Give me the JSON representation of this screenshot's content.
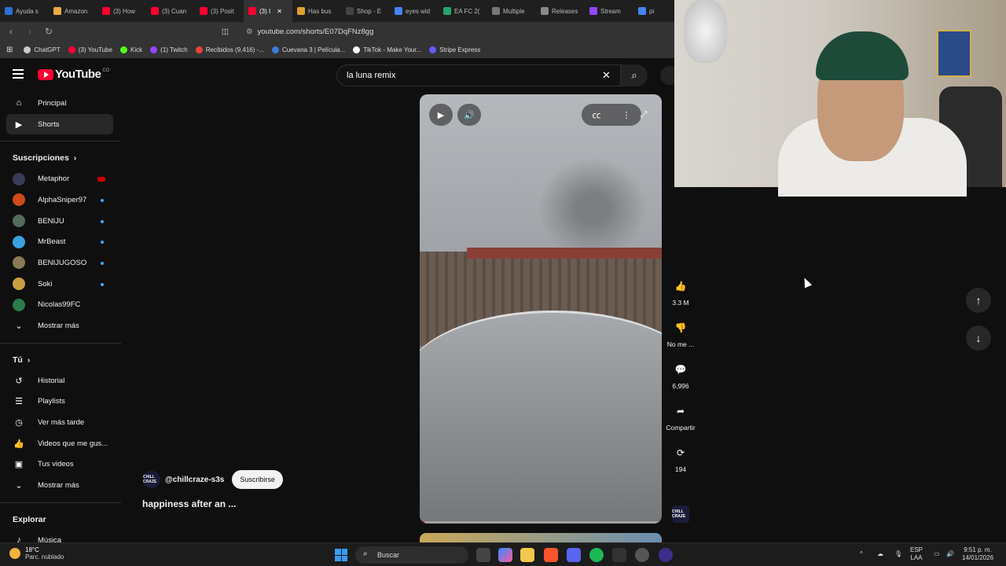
{
  "browser": {
    "tabs": [
      {
        "label": "Ayuda s",
        "color": "#2d6fd6"
      },
      {
        "label": "Amazon",
        "color": "#f3a847"
      },
      {
        "label": "(3) How",
        "color": "#ff0033"
      },
      {
        "label": "(3) Cuan",
        "color": "#ff0033"
      },
      {
        "label": "(3) Posit",
        "color": "#ff0033"
      },
      {
        "label": "(3) I",
        "color": "#ff0033",
        "active": true
      },
      {
        "label": "Has bus",
        "color": "#e0a030"
      },
      {
        "label": "Shop - E",
        "color": "#444"
      },
      {
        "label": "eyes wid",
        "color": "#4285f4"
      },
      {
        "label": "EA FC 2(",
        "color": "#26a26a"
      },
      {
        "label": "Multiple",
        "color": "#777"
      },
      {
        "label": "Releases",
        "color": "#888"
      },
      {
        "label": "Stream",
        "color": "#9146ff"
      },
      {
        "label": "pi",
        "color": "#4285f4"
      }
    ],
    "url": "youtube.com/shorts/E07DqFNz8gg",
    "bookmarks": [
      {
        "label": "ChatGPT",
        "color": "#ccc"
      },
      {
        "label": "(3) YouTube",
        "color": "#ff0033"
      },
      {
        "label": "Kick",
        "color": "#53fc18"
      },
      {
        "label": "(1) Twitch",
        "color": "#9146ff"
      },
      {
        "label": "Recibidos (9,416) -...",
        "color": "#ea4335"
      },
      {
        "label": "Cuevana 3 | Película...",
        "color": "#3b7dd8"
      },
      {
        "label": "TikTok - Make Your...",
        "color": "#fff"
      },
      {
        "label": "Stripe Express",
        "color": "#635bff"
      }
    ]
  },
  "youtube": {
    "logo_text": "YouTube",
    "logo_country": "CO",
    "search_value": "la luna remix"
  },
  "sidebar": {
    "main": [
      {
        "label": "Principal",
        "icon": "home-icon",
        "glyph": "⌂"
      },
      {
        "label": "Shorts",
        "icon": "shorts-icon",
        "glyph": "▶",
        "selected": true
      }
    ],
    "subs_heading": "Suscripciones",
    "subs": [
      {
        "label": "Metaphor",
        "color": "#3a3a5a",
        "live": true
      },
      {
        "label": "AlphaSniper97",
        "color": "#d04a1a",
        "dot": true
      },
      {
        "label": "BENIJU",
        "color": "#556b5a",
        "dot": true
      },
      {
        "label": "MrBeast",
        "color": "#3aa0e0",
        "dot": true
      },
      {
        "label": "BENIJUGOSO",
        "color": "#8a7a5a",
        "dot": true
      },
      {
        "label": "Soki",
        "color": "#c9a040",
        "dot": true
      },
      {
        "label": "Nicolas99FC",
        "color": "#2a7a4a"
      }
    ],
    "subs_more": "Mostrar más",
    "you_heading": "Tú",
    "you": [
      {
        "label": "Historial",
        "glyph": "↺"
      },
      {
        "label": "Playlists",
        "glyph": "☰"
      },
      {
        "label": "Ver más tarde",
        "glyph": "◷"
      },
      {
        "label": "Videos que me gus...",
        "glyph": "👍"
      },
      {
        "label": "Tus videos",
        "glyph": "▣"
      }
    ],
    "you_more": "Mostrar más",
    "explore_heading": "Explorar",
    "explore": [
      {
        "label": "Música",
        "glyph": "♪"
      }
    ]
  },
  "short": {
    "channel_handle": "@chillcraze-s3s",
    "channel_badge": "CHILL CRAZE",
    "subscribe_label": "Suscribirse",
    "title": "happiness after an ...",
    "progress": 0.02,
    "actions": [
      {
        "name": "like",
        "glyph": "👍",
        "label": "3.3 M"
      },
      {
        "name": "dislike",
        "glyph": "👎",
        "label": "No me ..."
      },
      {
        "name": "comments",
        "glyph": "💬",
        "label": "6,996"
      },
      {
        "name": "share",
        "glyph": "➦",
        "label": "Compartir"
      },
      {
        "name": "remix",
        "glyph": "⟳",
        "label": "194"
      }
    ]
  },
  "taskbar": {
    "temp": "18°C",
    "weather": "Parc. nublado",
    "search_placeholder": "Buscar",
    "lang1": "ESP",
    "lang2": "LAA",
    "time": "9:51 p. m.",
    "date": "14/01/2026"
  }
}
